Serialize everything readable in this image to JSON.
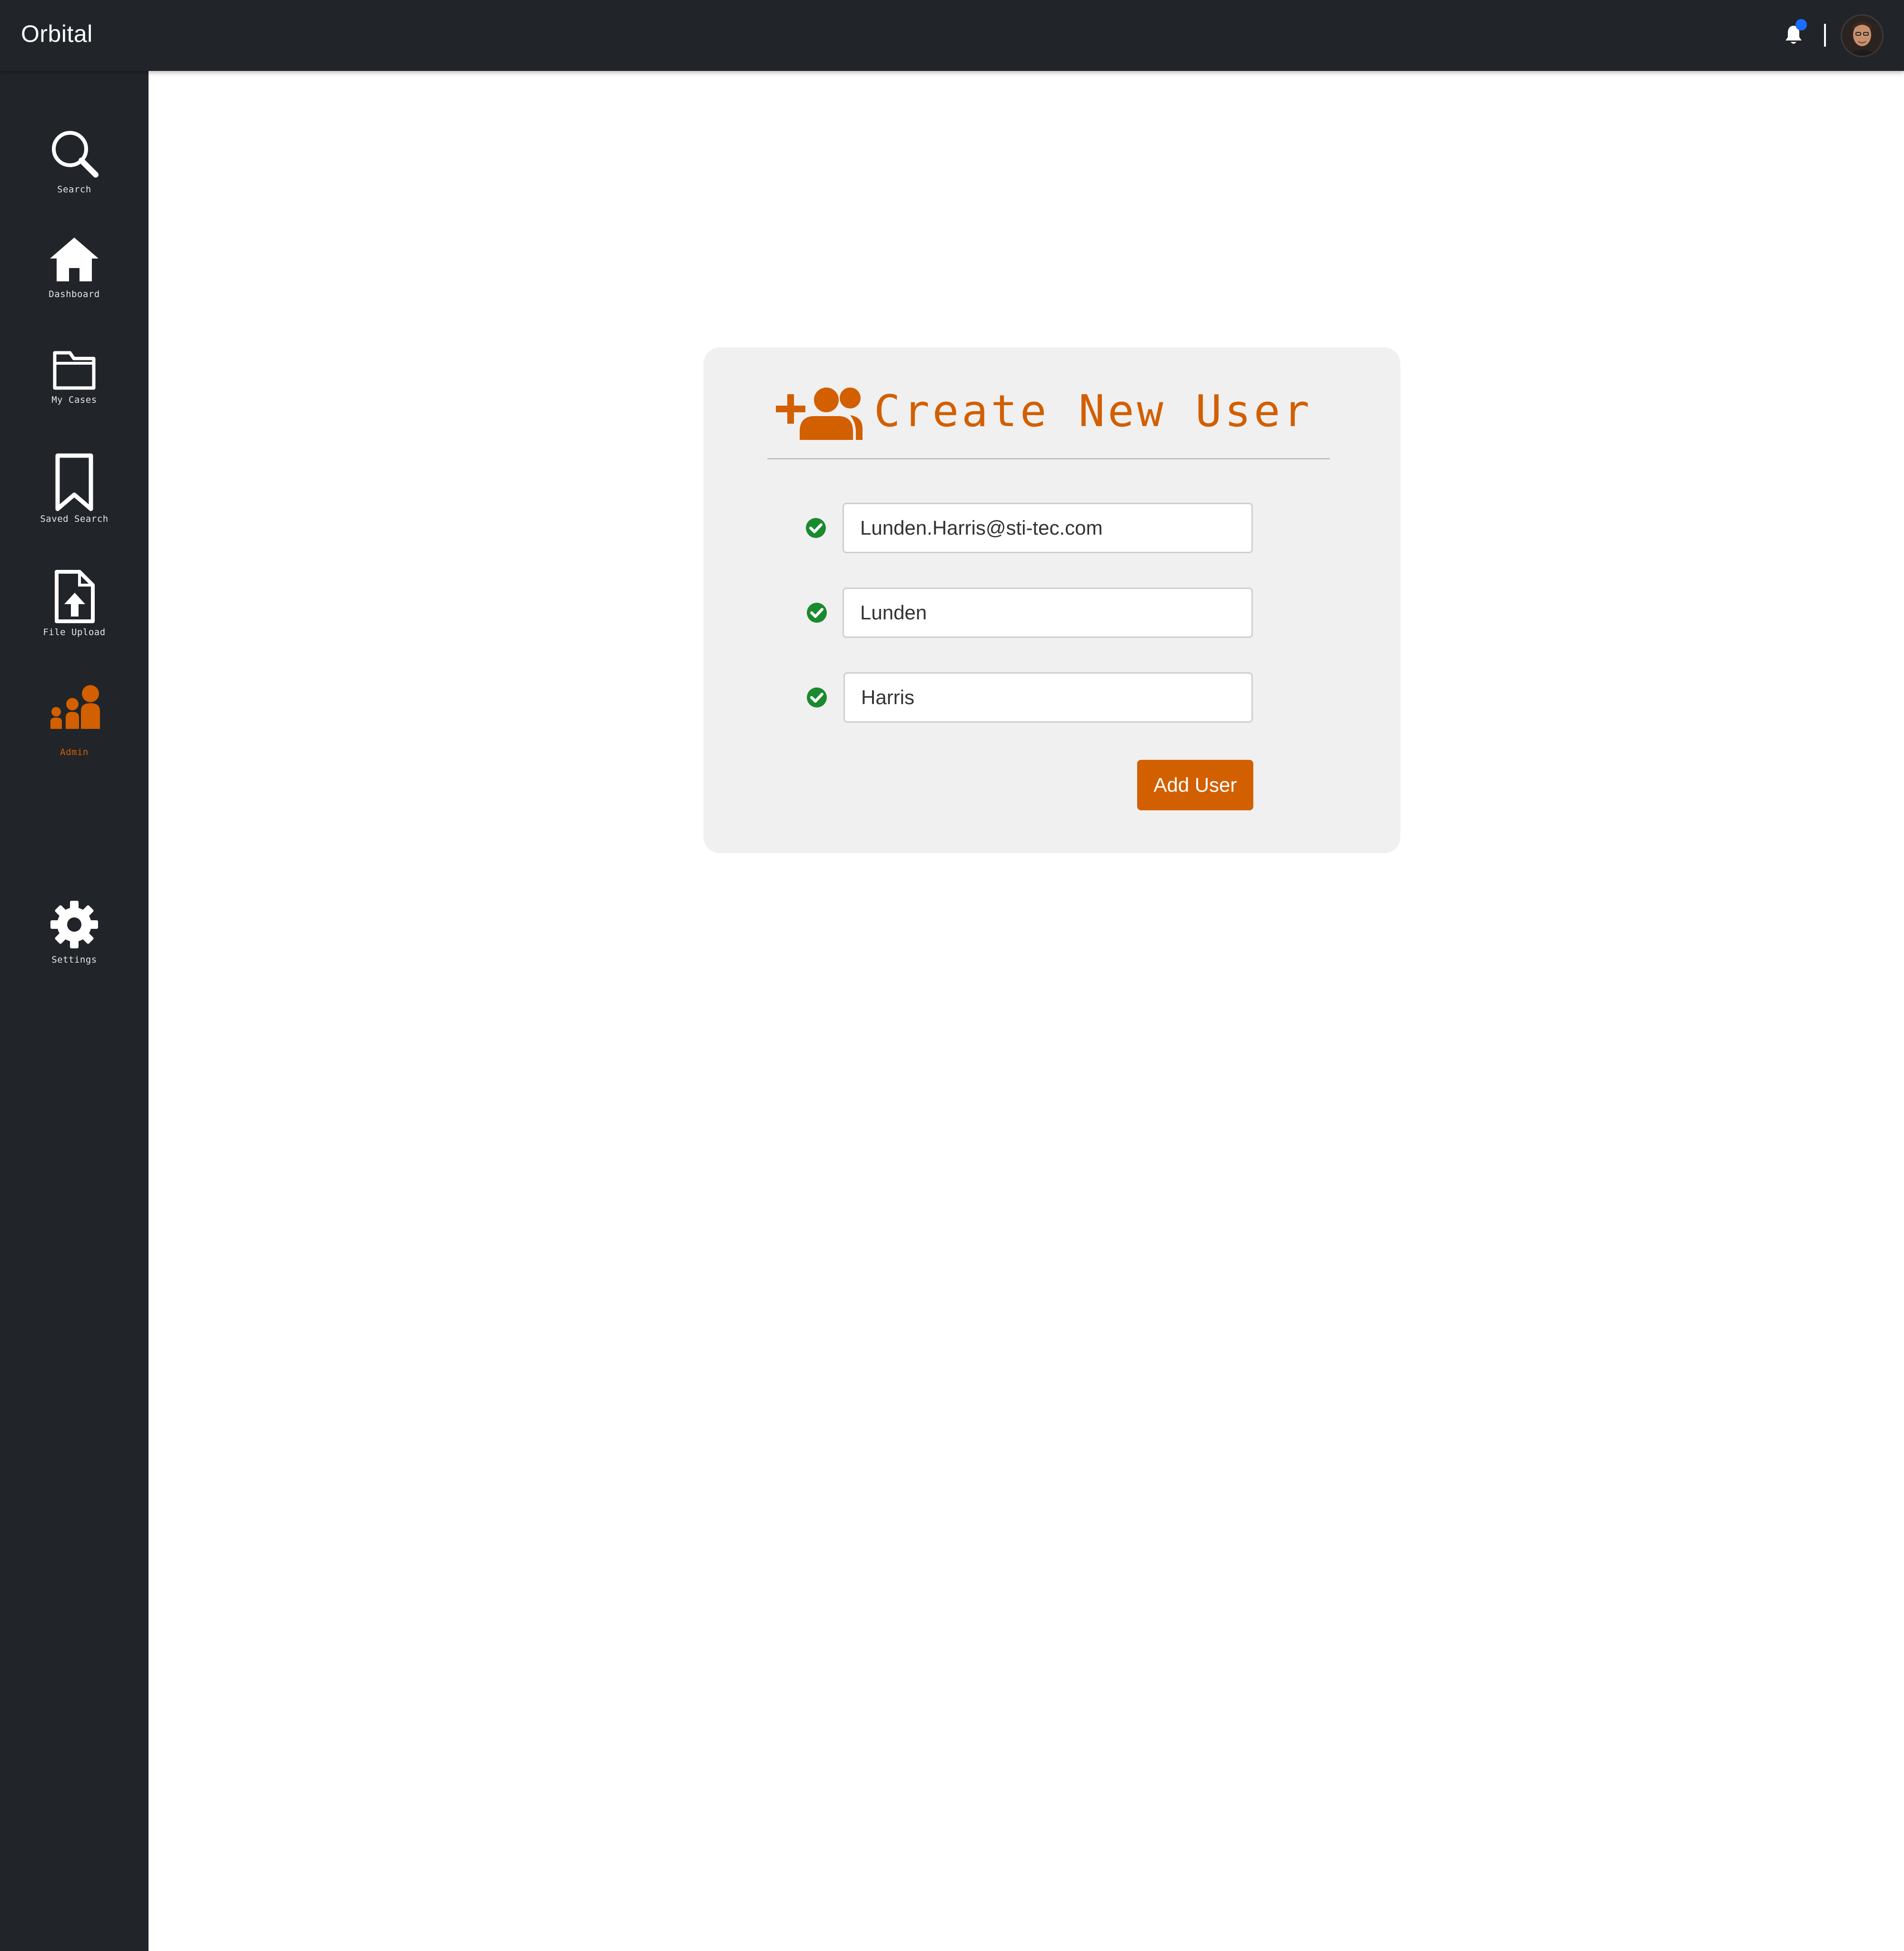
{
  "app": {
    "title": "Orbital"
  },
  "header": {
    "notifications_icon": "bell-icon",
    "notification_dot_color": "#1a6dff",
    "avatar_icon": "user-avatar"
  },
  "sidebar": {
    "items": [
      {
        "label": "Search",
        "icon": "search-icon",
        "active": false
      },
      {
        "label": "Dashboard",
        "icon": "home-icon",
        "active": false
      },
      {
        "label": "My Cases",
        "icon": "folder-icon",
        "active": false
      },
      {
        "label": "Saved Search",
        "icon": "bookmark-icon",
        "active": false
      },
      {
        "label": "File Upload",
        "icon": "file-upload-icon",
        "active": false
      },
      {
        "label": "Admin",
        "icon": "users-icon",
        "active": true
      },
      {
        "label": "Settings",
        "icon": "gear-icon",
        "active": false
      }
    ]
  },
  "form": {
    "title": "Create New User",
    "header_icon": "add-users-icon",
    "fields": [
      {
        "value": "Lunden.Harris@sti-tec.com",
        "status_icon": "check-circle-icon"
      },
      {
        "value": "Lunden",
        "status_icon": "check-circle-icon"
      },
      {
        "value": "Harris",
        "status_icon": "check-circle-icon"
      }
    ],
    "submit_label": "Add User"
  },
  "colors": {
    "accent": "#d25f00",
    "sidebar_bg": "#212429",
    "topbar_bg": "#212429",
    "card_bg": "#f0f0f0",
    "valid": "#1a8a2e"
  }
}
